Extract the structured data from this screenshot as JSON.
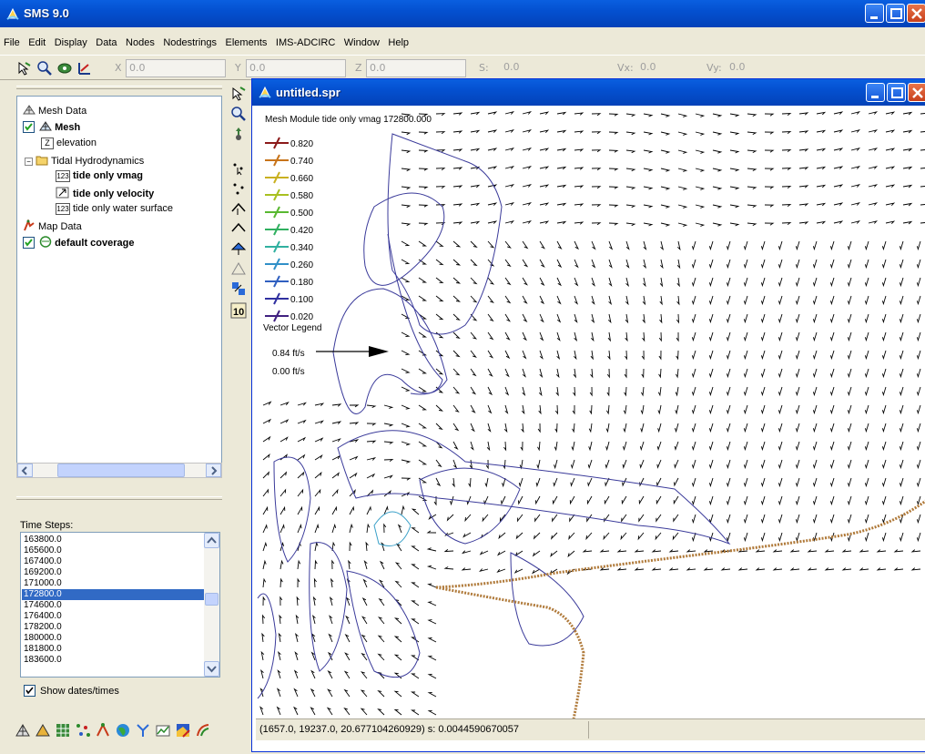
{
  "window": {
    "title": "SMS 9.0"
  },
  "menu": [
    "File",
    "Edit",
    "Display",
    "Data",
    "Nodes",
    "Nodestrings",
    "Elements",
    "IMS-ADCIRC",
    "Window",
    "Help"
  ],
  "toolbar": {
    "x_label": "X",
    "x_value": "0.0",
    "y_label": "Y",
    "y_value": "0.0",
    "z_label": "Z",
    "z_value": "0.0",
    "s_label": "S:",
    "s_value": "0.0",
    "vx_label": "Vx:",
    "vx_value": "0.0",
    "vy_label": "Vy:",
    "vy_value": "0.0"
  },
  "tree": {
    "mesh_data": "Mesh Data",
    "mesh": "Mesh",
    "elevation": "elevation",
    "tidal": "Tidal Hydrodynamics",
    "vmag": "tide only vmag",
    "velocity": "tide only velocity",
    "water_surface": "tide only water surface",
    "map_data": "Map Data",
    "coverage": "default coverage"
  },
  "timesteps": {
    "label": "Time Steps:",
    "items": [
      "163800.0",
      "165600.0",
      "167400.0",
      "169200.0",
      "171000.0",
      "172800.0",
      "174600.0",
      "176400.0",
      "178200.0",
      "180000.0",
      "181800.0",
      "183600.0"
    ],
    "selected": "172800.0",
    "show_dates": "Show dates/times"
  },
  "child_window": {
    "title": "untitled.spr",
    "status": "(1657.0, 19237.0, 20.677104260929) s: 0.0044590670057"
  },
  "plot": {
    "header": "Mesh Module tide only vmag   172800.000",
    "contour_legend": [
      {
        "label": "0.820",
        "color": "#8b1a1a"
      },
      {
        "label": "0.740",
        "color": "#c8741a"
      },
      {
        "label": "0.660",
        "color": "#c9b020"
      },
      {
        "label": "0.580",
        "color": "#a8c020"
      },
      {
        "label": "0.500",
        "color": "#58b830"
      },
      {
        "label": "0.420",
        "color": "#30b060"
      },
      {
        "label": "0.340",
        "color": "#30b0a0"
      },
      {
        "label": "0.260",
        "color": "#3090c8"
      },
      {
        "label": "0.180",
        "color": "#3060c0"
      },
      {
        "label": "0.100",
        "color": "#3030a0"
      },
      {
        "label": "0.020",
        "color": "#402080"
      }
    ],
    "vector_legend_title": "Vector Legend",
    "vector_max": "0.84 ft/s",
    "vector_min": "0.00 ft/s",
    "boundary_color": "#b07a3a",
    "contour_color": "#3a3a9a"
  }
}
